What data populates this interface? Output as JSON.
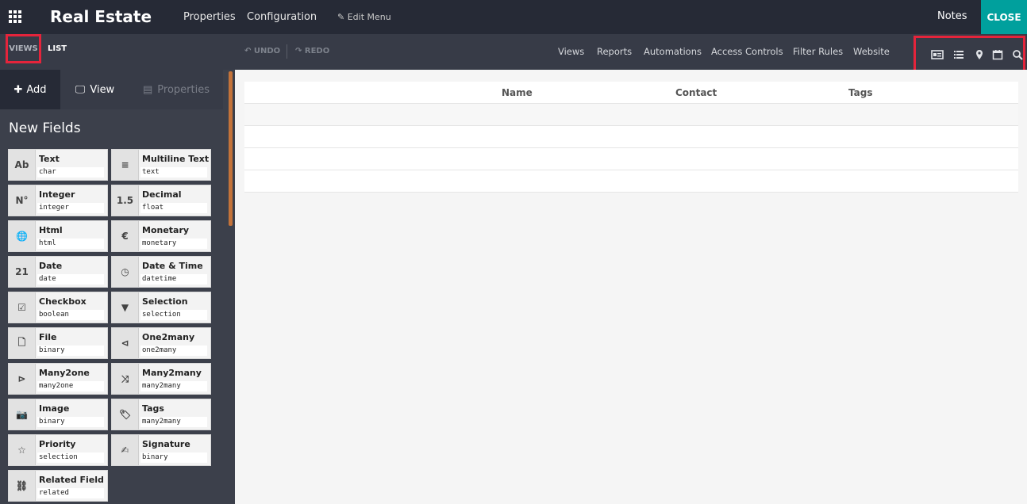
{
  "topbar": {
    "app_title": "Real Estate",
    "menus": [
      "Properties",
      "Configuration"
    ],
    "edit_menu": "Edit Menu",
    "notes": "Notes",
    "close": "CLOSE"
  },
  "subbar": {
    "views": "VIEWS",
    "list": "LIST",
    "undo": "UNDO",
    "redo": "REDO",
    "links": [
      "Views",
      "Reports",
      "Automations",
      "Access Controls",
      "Filter Rules",
      "Website"
    ],
    "view_icons": [
      "kanban-icon",
      "list-icon",
      "map-icon",
      "calendar-icon",
      "search-icon"
    ]
  },
  "sidebar": {
    "tabs": [
      "Add",
      "View",
      "Properties"
    ],
    "heading": "New Fields",
    "fields": [
      {
        "label": "Text",
        "type": "char",
        "icon": "Ab"
      },
      {
        "label": "Multiline Text",
        "type": "text",
        "icon": "≡"
      },
      {
        "label": "Integer",
        "type": "integer",
        "icon": "N°"
      },
      {
        "label": "Decimal",
        "type": "float",
        "icon": "1.5"
      },
      {
        "label": "Html",
        "type": "html",
        "icon": "🌐"
      },
      {
        "label": "Monetary",
        "type": "monetary",
        "icon": "€"
      },
      {
        "label": "Date",
        "type": "date",
        "icon": "21"
      },
      {
        "label": "Date & Time",
        "type": "datetime",
        "icon": "◷"
      },
      {
        "label": "Checkbox",
        "type": "boolean",
        "icon": "☑"
      },
      {
        "label": "Selection",
        "type": "selection",
        "icon": "▼"
      },
      {
        "label": "File",
        "type": "binary",
        "icon": "🗋"
      },
      {
        "label": "One2many",
        "type": "one2many",
        "icon": "⊲"
      },
      {
        "label": "Many2one",
        "type": "many2one",
        "icon": "⊳"
      },
      {
        "label": "Many2many",
        "type": "many2many",
        "icon": "⤨"
      },
      {
        "label": "Image",
        "type": "binary",
        "icon": "📷"
      },
      {
        "label": "Tags",
        "type": "many2many",
        "icon": "🏷"
      },
      {
        "label": "Priority",
        "type": "selection",
        "icon": "☆"
      },
      {
        "label": "Signature",
        "type": "binary",
        "icon": "✍"
      },
      {
        "label": "Related Field",
        "type": "related",
        "icon": "⛓"
      }
    ]
  },
  "main": {
    "columns": [
      "Name",
      "Contact",
      "Tags"
    ]
  }
}
